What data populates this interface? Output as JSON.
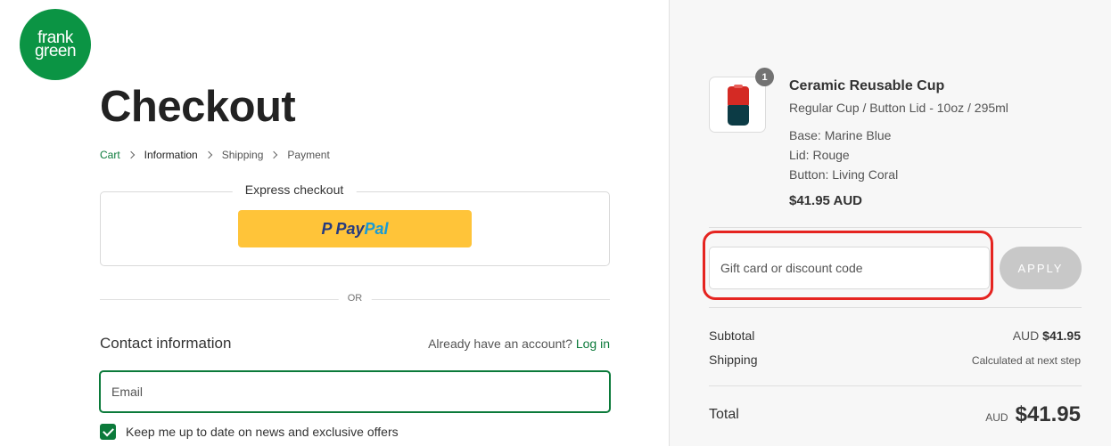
{
  "brand": {
    "logo_line1": "frank",
    "logo_line2": "green",
    "color": "#0b9444"
  },
  "page": {
    "title": "Checkout"
  },
  "breadcrumb": {
    "items": [
      "Cart",
      "Information",
      "Shipping",
      "Payment"
    ],
    "current": "Information"
  },
  "express": {
    "label": "Express checkout",
    "paypal_pay": "Pay",
    "paypal_pal": "Pal"
  },
  "divider": {
    "or": "OR"
  },
  "contact": {
    "title": "Contact information",
    "account_prompt": "Already have an account?",
    "login_link": "Log in",
    "email_placeholder": "Email",
    "newsletter_label": "Keep me up to date on news and exclusive offers",
    "newsletter_checked": true
  },
  "order": {
    "item": {
      "quantity": "1",
      "name": "Ceramic Reusable Cup",
      "variant": "Regular Cup / Button Lid - 10oz / 295ml",
      "options": [
        "Base: Marine Blue",
        "Lid: Rouge",
        "Button: Living Coral"
      ],
      "price": "$41.95 AUD"
    },
    "discount": {
      "placeholder": "Gift card or discount code",
      "apply_label": "APPLY",
      "highlight_color": "#e52420"
    },
    "subtotal": {
      "label": "Subtotal",
      "currency": "AUD",
      "amount": "$41.95"
    },
    "shipping": {
      "label": "Shipping",
      "value": "Calculated at next step"
    },
    "total": {
      "label": "Total",
      "currency": "AUD",
      "amount": "$41.95"
    }
  },
  "colors": {
    "accent": "#0b7a3a",
    "paypal_yellow": "#ffc439",
    "sidebar_bg": "#f7f7f7"
  }
}
